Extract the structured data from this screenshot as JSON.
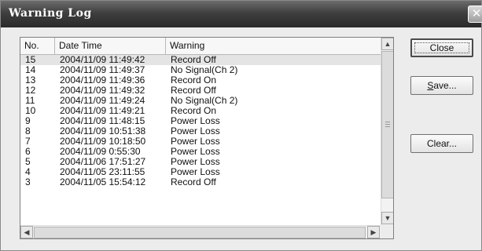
{
  "window": {
    "title": "Warning Log",
    "close_glyph": "✕"
  },
  "table": {
    "columns": [
      "No.",
      "Date Time",
      "Warning"
    ],
    "rows": [
      {
        "no": "15",
        "datetime": "2004/11/09 11:49:42",
        "warning": "Record Off",
        "selected": true
      },
      {
        "no": "14",
        "datetime": "2004/11/09 11:49:37",
        "warning": "No Signal(Ch 2)"
      },
      {
        "no": "13",
        "datetime": "2004/11/09 11:49:36",
        "warning": "Record On"
      },
      {
        "no": "12",
        "datetime": "2004/11/09 11:49:32",
        "warning": "Record Off"
      },
      {
        "no": "11",
        "datetime": "2004/11/09 11:49:24",
        "warning": "No Signal(Ch 2)"
      },
      {
        "no": "10",
        "datetime": "2004/11/09 11:49:21",
        "warning": "Record On"
      },
      {
        "no": "9",
        "datetime": "2004/11/09 11:48:15",
        "warning": "Power Loss"
      },
      {
        "no": "8",
        "datetime": "2004/11/09 10:51:38",
        "warning": "Power Loss"
      },
      {
        "no": "7",
        "datetime": "2004/11/09 10:18:50",
        "warning": "Power Loss"
      },
      {
        "no": "6",
        "datetime": "2004/11/09 0:55:30",
        "warning": "Power Loss"
      },
      {
        "no": "5",
        "datetime": "2004/11/06 17:51:27",
        "warning": "Power Loss"
      },
      {
        "no": "4",
        "datetime": "2004/11/05 23:11:55",
        "warning": "Power Loss"
      },
      {
        "no": "3",
        "datetime": "2004/11/05 15:54:12",
        "warning": "Record Off"
      }
    ]
  },
  "scrollbar": {
    "up_icon": "▲",
    "down_icon": "▼",
    "left_icon": "◀",
    "right_icon": "▶"
  },
  "buttons": {
    "close": "Close",
    "save_mnemonic": "S",
    "save_rest": "ave...",
    "clear": "Clear..."
  },
  "colors": {
    "titlebar": "#3f3f3f",
    "selection": "#e4e4e4",
    "window_bg": "#ececec"
  }
}
